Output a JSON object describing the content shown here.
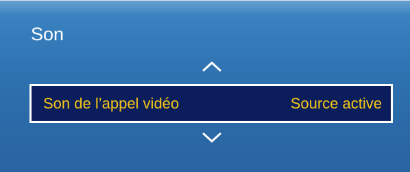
{
  "menu": {
    "title": "Son",
    "nav_up_icon": "chevron-up-icon",
    "nav_down_icon": "chevron-down-icon",
    "selected_item": {
      "label": "Son de l’appel vidéo",
      "value": "Source active"
    }
  },
  "colors": {
    "panel_background": "#2f73b2",
    "selection_background": "#0b1e5b",
    "selection_border": "#ffffff",
    "selection_text": "#f5c518",
    "title_text": "#ffffff"
  }
}
